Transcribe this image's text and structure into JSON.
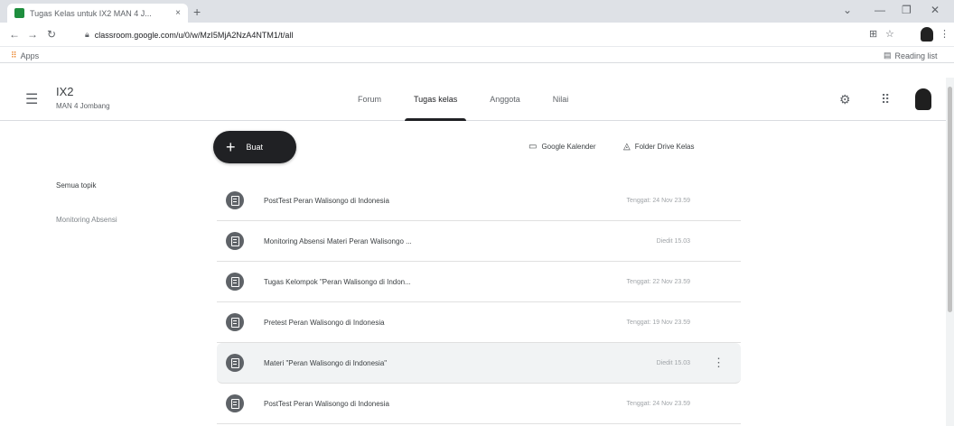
{
  "browser": {
    "tab_title": "Tugas Kelas untuk IX2 MAN 4 J...",
    "tab_close": "×",
    "new_tab": "+",
    "url": "classroom.google.com/u/0/w/MzI5MjA2NzA4NTM1/t/all",
    "bookmarks_apps": "Apps",
    "reading_list": "Reading list"
  },
  "header": {
    "class_name": "IX2",
    "class_subtitle": "MAN 4 Jombang",
    "tabs": [
      {
        "label": "Forum"
      },
      {
        "label": "Tugas kelas"
      },
      {
        "label": "Anggota"
      },
      {
        "label": "Nilai"
      }
    ]
  },
  "toolbar": {
    "create_label": "Buat",
    "calendar_label": "Google Kalender",
    "drive_label": "Folder Drive Kelas"
  },
  "topics": [
    {
      "label": "Semua topik"
    },
    {
      "label": "Monitoring Absensi"
    }
  ],
  "items": [
    {
      "title": "PostTest Peran Walisongo di Indonesia",
      "meta": "Tenggat: 24 Nov 23.59"
    },
    {
      "title": "Monitoring Absensi Materi Peran Walisongo ...",
      "meta": "Diedit 15.03"
    },
    {
      "title": "Tugas Kelompok \"Peran Walisongo di Indon...",
      "meta": "Tenggat: 22 Nov 23.59"
    },
    {
      "title": "Pretest Peran Walisongo di Indonesia",
      "meta": "Tenggat: 19 Nov 23.59"
    },
    {
      "title": "Materi \"Peran Walisongo di Indonesia\"",
      "meta": "Diedit 15.03"
    },
    {
      "title": "PostTest Peran Walisongo di Indonesia",
      "meta": "Tenggat: 24 Nov 23.59"
    }
  ],
  "colors": {
    "accent": "#202124",
    "chrome_bg": "#dee1e6",
    "row_highlight": "#f1f3f4"
  }
}
